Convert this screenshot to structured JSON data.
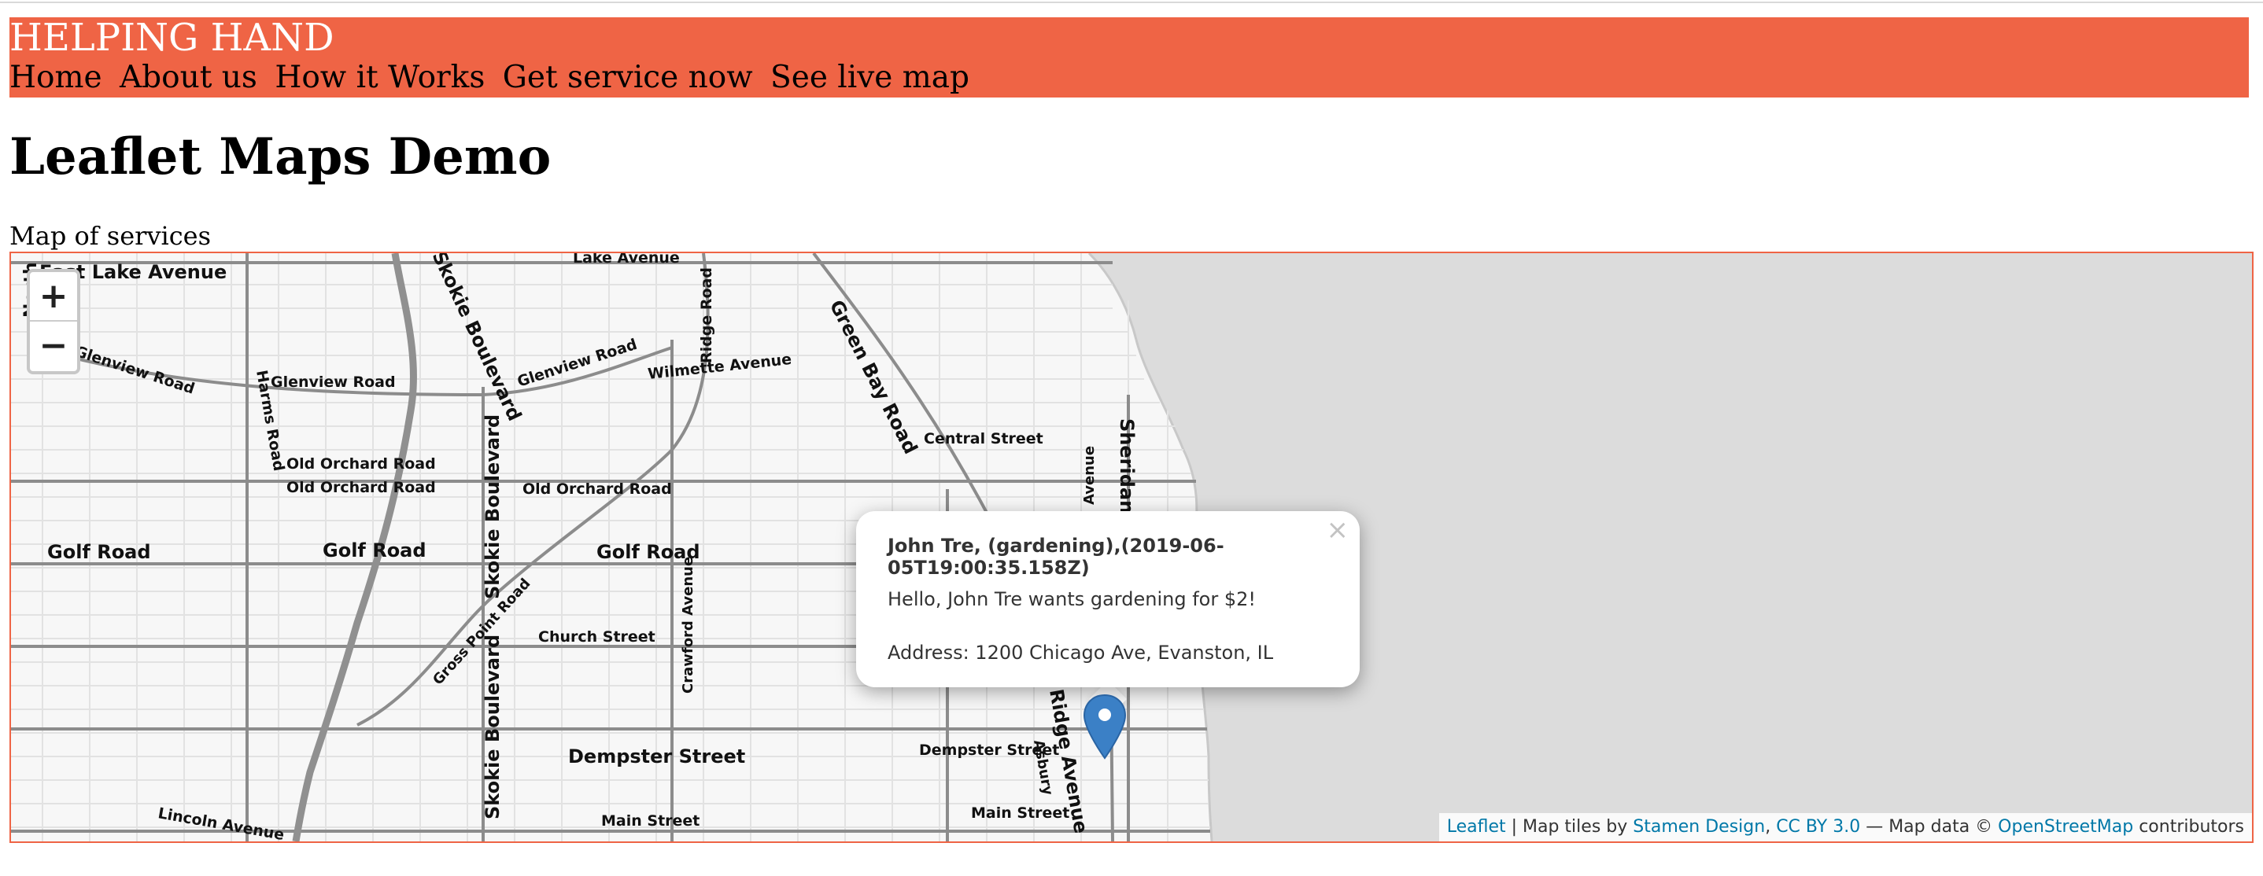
{
  "site": {
    "brand": "HELPING HAND",
    "nav": [
      "Home",
      "About us",
      "How it Works",
      "Get service now",
      "See live map"
    ]
  },
  "page": {
    "title": "Leaflet Maps Demo",
    "subtitle": "Map of services"
  },
  "map": {
    "zoom_in": "+",
    "zoom_out": "−",
    "water_color": "#dcdcdc",
    "land_color": "#f7f7f7",
    "road_color": "#8c8c8c",
    "marker_color": "#3b80c6",
    "labels": [
      "North",
      "East Lake Avenue",
      "Lake Avenue",
      "Skokie Boulevard",
      "Ridge Road",
      "Green Bay Road",
      "Glenview Road",
      "Harms Road",
      "Glenview Road",
      "Glenview Road",
      "Wilmette Avenue",
      "Central Street",
      "Avenue",
      "Sheridan Road",
      "Old Orchard Road",
      "Old Orchard Road",
      "Old Orchard Road",
      "Skokie Boulevard",
      "Golf Road",
      "Golf Road",
      "Golf Road",
      "Crawford Avenue",
      "Gross Point Road",
      "Church Street",
      "Asbury",
      "Ridge Avenue",
      "Dempster Street",
      "Dempster Street",
      "Skokie Boulevard",
      "Lincoln Avenue",
      "Main Street",
      "Main Street"
    ],
    "popup": {
      "close": "×",
      "title": "John Tre, (gardening),(2019-06-05T19:00:35.158Z)",
      "message": "Hello, John Tre wants gardening for $2!",
      "address": "Address: 1200 Chicago Ave, Evanston, IL"
    },
    "attribution": {
      "leaflet": "Leaflet",
      "sep1": " | Map tiles by ",
      "stamen": "Stamen Design",
      "sep2": ", ",
      "license": "CC BY 3.0",
      "sep3": " — Map data © ",
      "osm": "OpenStreetMap",
      "sep4": " contributors"
    }
  }
}
